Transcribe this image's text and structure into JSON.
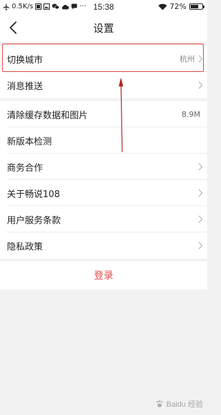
{
  "status_bar": {
    "network_speed": "0.5K/s",
    "time": "15:38",
    "battery": "72%",
    "battery_level": 0.72
  },
  "header": {
    "title": "设置"
  },
  "settings": {
    "switch_city": {
      "label": "切换城市",
      "value": "杭州"
    },
    "notifications": {
      "label": "消息推送"
    },
    "clear_cache": {
      "label": "清除缓存数据和图片",
      "value": "8.9M"
    },
    "version_check": {
      "label": "新版本检测"
    },
    "business": {
      "label": "商务合作"
    },
    "about": {
      "label": "关于畅说108"
    },
    "terms": {
      "label": "用户服务条款"
    },
    "privacy": {
      "label": "隐私政策"
    }
  },
  "login": {
    "label": "登录"
  },
  "watermark": {
    "text": "Baidu 经验",
    "url": "jingyan.baidu.com"
  },
  "colors": {
    "accent": "#e24a4a",
    "highlight": "#e0443e"
  }
}
